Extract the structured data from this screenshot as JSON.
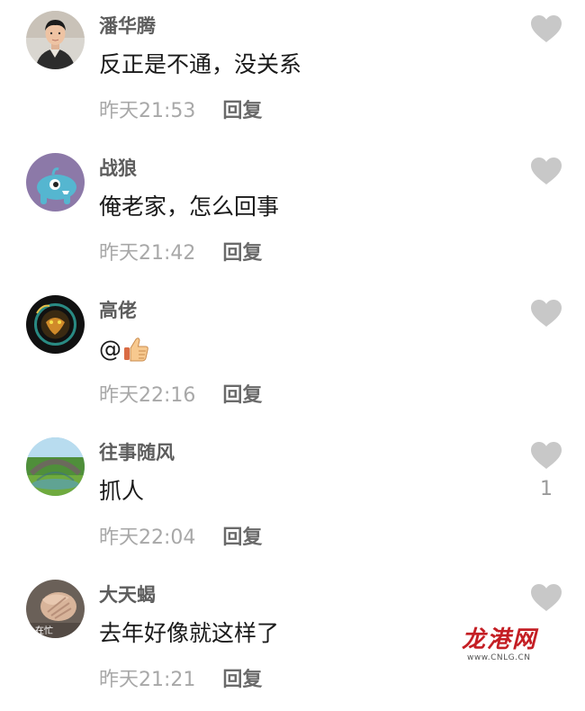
{
  "comments": [
    {
      "username": "潘华腾",
      "content": "反正是不通，没关系",
      "time": "昨天21:53",
      "reply": "回复",
      "likes": ""
    },
    {
      "username": "战狼",
      "content": "俺老家，怎么回事",
      "time": "昨天21:42",
      "reply": "回复",
      "likes": ""
    },
    {
      "username": "高佬",
      "content": "@",
      "time": "昨天22:16",
      "reply": "回复",
      "likes": ""
    },
    {
      "username": "往事随风",
      "content": "抓人",
      "time": "昨天22:04",
      "reply": "回复",
      "likes": "1"
    },
    {
      "username": "大天蝎",
      "content": "去年好像就这样了",
      "time": "昨天21:21",
      "reply": "回复",
      "likes": "",
      "avatar_text": "在忙"
    }
  ],
  "watermark": {
    "logo": "龙港网",
    "url": "www.CNLG.CN"
  },
  "colors": {
    "username": "#5d5d5d",
    "content": "#1a1a1a",
    "time": "#a8a8a8",
    "reply": "#6a6a6a",
    "like_icon": "#c8c8c8",
    "watermark": "#c41e24"
  },
  "icons": {
    "like": "heart-icon",
    "emoji": "thumbs-up-emoji"
  }
}
